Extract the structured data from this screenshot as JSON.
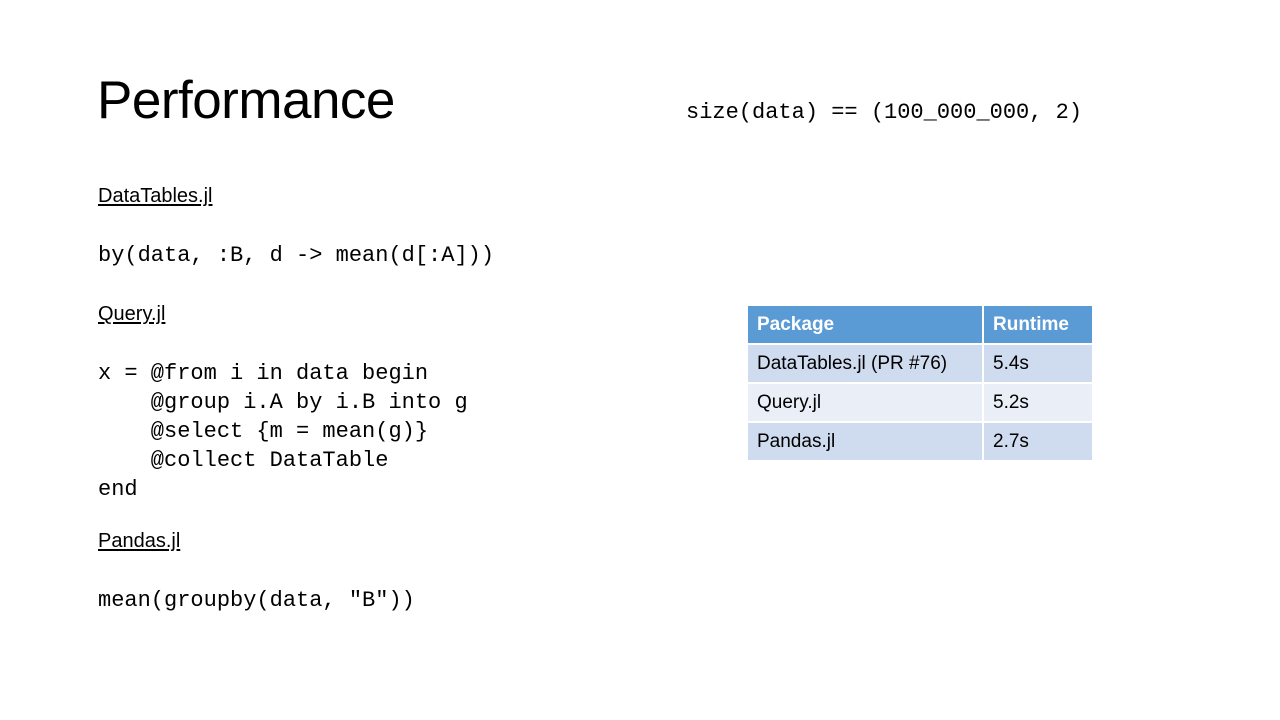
{
  "slide": {
    "title": "Performance",
    "size_expr": "size(data) == (100_000_000, 2)",
    "sections": [
      {
        "heading": "DataTables.jl",
        "code": "by(data, :B, d -> mean(d[:A]))"
      },
      {
        "heading": "Query.jl",
        "code": "x = @from i in data begin\n    @group i.A by i.B into g\n    @select {m = mean(g)}\n    @collect DataTable\nend"
      },
      {
        "heading": "Pandas.jl",
        "code": "mean(groupby(data, \"B\"))"
      }
    ],
    "table": {
      "headers": [
        "Package",
        "Runtime"
      ],
      "rows": [
        [
          "DataTables.jl (PR #76)",
          "5.4s"
        ],
        [
          "Query.jl",
          "5.2s"
        ],
        [
          "Pandas.jl",
          "2.7s"
        ]
      ],
      "colors": {
        "header_bg": "#5b9bd5",
        "row_odd_bg": "#cfdbee",
        "row_even_bg": "#e9eef7"
      }
    }
  }
}
